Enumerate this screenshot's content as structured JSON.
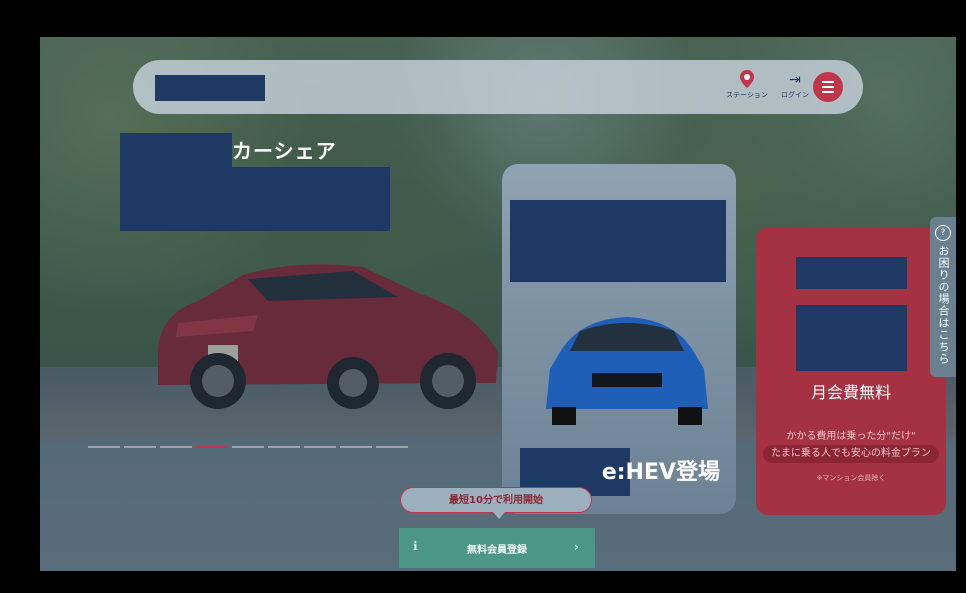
{
  "header": {
    "station_label": "ステーション",
    "login_label": "ログイン",
    "station_icon": "map-pin-icon",
    "login_icon": "login-icon",
    "menu_icon": "hamburger-menu-icon"
  },
  "hero": {
    "subtitle": "カーシェア",
    "pagination": {
      "count": 9,
      "active_index": 3
    }
  },
  "card_ehev": {
    "suffix": "e:HEV登場"
  },
  "card_free": {
    "headline": "月会費無料",
    "line1": "かかる費用は乗った分\"だけ\"",
    "pill_text": "たまに乗る人でも安心の料金プラン",
    "note": "※マンション会員除く"
  },
  "side_tab": {
    "icon": "question-circle-icon",
    "label": "お困りの場合はこちら"
  },
  "cta": {
    "bubble_text": "最短10分で利用開始",
    "button_label": "無料会員登録",
    "button_icon": "info-icon",
    "arrow": "›"
  },
  "colors": {
    "brand_navy": "#1e3a64",
    "accent_red": "#c0364a",
    "cta_green": "#4c9686"
  }
}
